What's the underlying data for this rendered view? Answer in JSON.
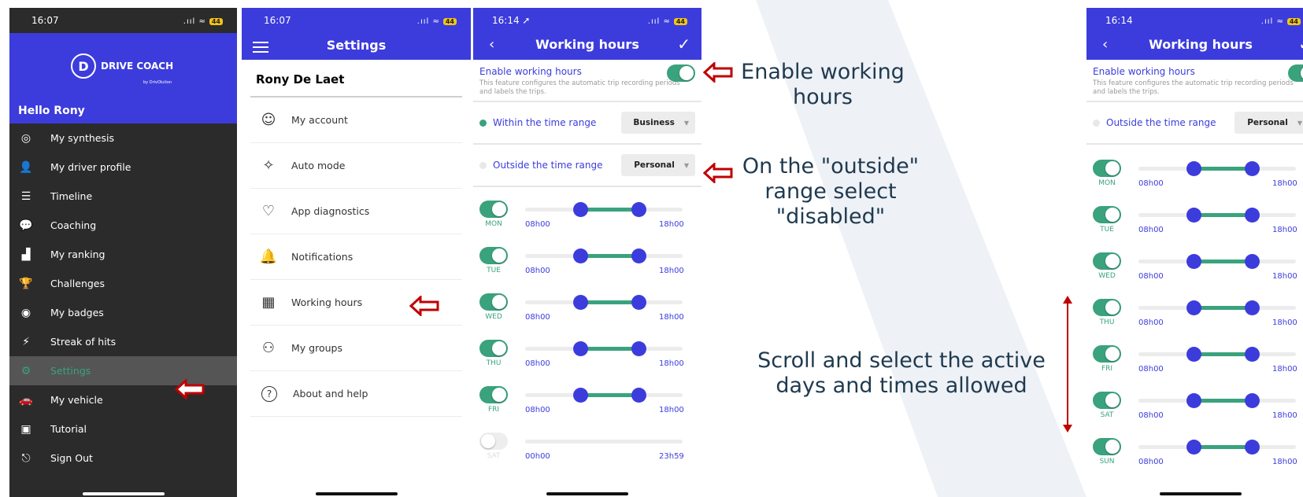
{
  "phone1": {
    "time": "16:07",
    "battery": "44",
    "logo_text": "DRIVE COACH",
    "logo_letter": "D",
    "logo_by": "by DrivOlution",
    "greeting": "Hello Rony",
    "menu": [
      {
        "label": "My synthesis",
        "icon": "speedometer-icon"
      },
      {
        "label": "My driver profile",
        "icon": "user-icon"
      },
      {
        "label": "Timeline",
        "icon": "timeline-icon"
      },
      {
        "label": "Coaching",
        "icon": "chat-icon"
      },
      {
        "label": "My ranking",
        "icon": "podium-icon"
      },
      {
        "label": "Challenges",
        "icon": "trophy-icon"
      },
      {
        "label": "My badges",
        "icon": "badge-icon"
      },
      {
        "label": "Streak of hits",
        "icon": "streak-icon"
      },
      {
        "label": "Settings",
        "icon": "gear-icon",
        "active": true
      },
      {
        "label": "My vehicle",
        "icon": "car-icon"
      },
      {
        "label": "Tutorial",
        "icon": "tutorial-icon"
      },
      {
        "label": "Sign Out",
        "icon": "sign-out-icon"
      }
    ]
  },
  "phone2": {
    "time": "16:07",
    "battery": "44",
    "title": "Settings",
    "user_name": "Rony De Laet",
    "menu": [
      {
        "label": "My account",
        "icon": "account-icon"
      },
      {
        "label": "Auto mode",
        "icon": "magic-wand-icon"
      },
      {
        "label": "App diagnostics",
        "icon": "diagnostics-icon"
      },
      {
        "label": "Notifications",
        "icon": "bell-icon"
      },
      {
        "label": "Working hours",
        "icon": "calendar-clock-icon"
      },
      {
        "label": "My groups",
        "icon": "group-icon"
      },
      {
        "label": "About and help",
        "icon": "help-icon"
      }
    ]
  },
  "phone3": {
    "time": "16:14",
    "battery": "44",
    "title": "Working hours",
    "enable_label": "Enable working hours",
    "enable_desc": "This feature configures the automatic trip recording periods and labels the trips.",
    "within_label": "Within the time range",
    "within_value": "Business",
    "outside_label": "Outside the time range",
    "outside_value": "Personal",
    "days": [
      {
        "label": "MON",
        "on": true,
        "start": "08h00",
        "end": "18h00",
        "from": 0.35,
        "to": 0.72
      },
      {
        "label": "TUE",
        "on": true,
        "start": "08h00",
        "end": "18h00",
        "from": 0.35,
        "to": 0.72
      },
      {
        "label": "WED",
        "on": true,
        "start": "08h00",
        "end": "18h00",
        "from": 0.35,
        "to": 0.72
      },
      {
        "label": "THU",
        "on": true,
        "start": "08h00",
        "end": "18h00",
        "from": 0.35,
        "to": 0.72
      },
      {
        "label": "FRI",
        "on": true,
        "start": "08h00",
        "end": "18h00",
        "from": 0.35,
        "to": 0.72
      },
      {
        "label": "SAT",
        "on": false,
        "start": "00h00",
        "end": "23h59",
        "from": 0,
        "to": 1
      }
    ]
  },
  "phone4": {
    "time": "16:14",
    "battery": "44",
    "title": "Working hours",
    "enable_label": "Enable working hours",
    "enable_desc": "This feature configures the automatic trip recording periods and labels the trips.",
    "outside_label": "Outside the time range",
    "outside_value": "Personal",
    "days": [
      {
        "label": "MON",
        "on": true,
        "start": "08h00",
        "end": "18h00",
        "from": 0.35,
        "to": 0.72
      },
      {
        "label": "TUE",
        "on": true,
        "start": "08h00",
        "end": "18h00",
        "from": 0.35,
        "to": 0.72
      },
      {
        "label": "WED",
        "on": true,
        "start": "08h00",
        "end": "18h00",
        "from": 0.35,
        "to": 0.72
      },
      {
        "label": "THU",
        "on": true,
        "start": "08h00",
        "end": "18h00",
        "from": 0.35,
        "to": 0.72
      },
      {
        "label": "FRI",
        "on": true,
        "start": "08h00",
        "end": "18h00",
        "from": 0.35,
        "to": 0.72
      },
      {
        "label": "SAT",
        "on": true,
        "start": "08h00",
        "end": "18h00",
        "from": 0.35,
        "to": 0.72
      },
      {
        "label": "SUN",
        "on": true,
        "start": "08h00",
        "end": "18h00",
        "from": 0.35,
        "to": 0.72
      }
    ]
  },
  "annotations": {
    "enable": [
      "Enable working",
      "hours"
    ],
    "outside": [
      "On the \"outside\"",
      "range select",
      "\"disabled\""
    ],
    "scroll": [
      "Scroll and select the active",
      "days and times allowed"
    ]
  },
  "colors": {
    "brand": "#3c3cdc",
    "green": "#3aa27d",
    "arrow": "#c00000",
    "dark": "#2b2b2b"
  }
}
